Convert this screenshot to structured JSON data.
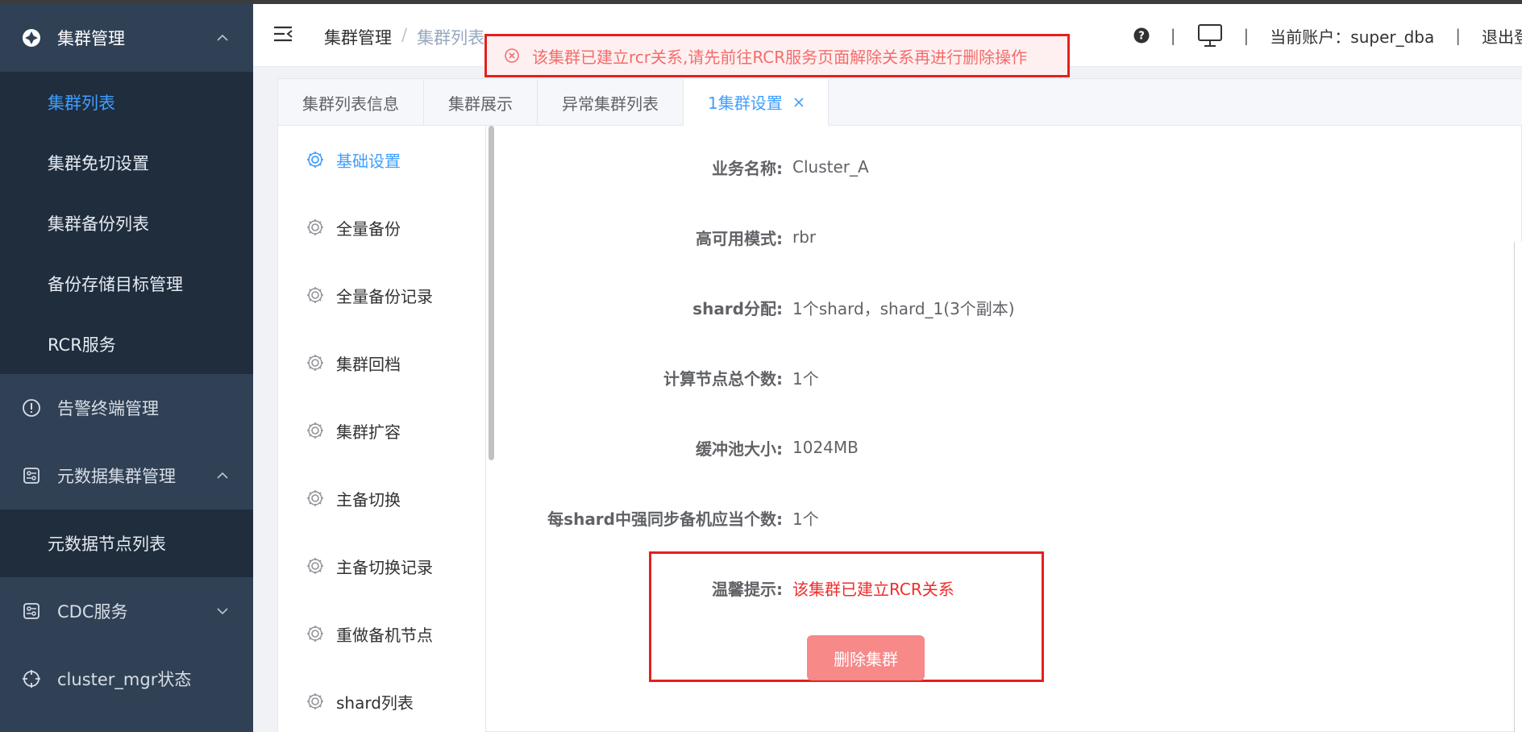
{
  "sidebar": {
    "groups": [
      {
        "label": "集群管理",
        "icon": "cluster-icon",
        "expanded": true,
        "items": [
          {
            "label": "集群列表",
            "active": true
          },
          {
            "label": "集群免切设置"
          },
          {
            "label": "集群备份列表"
          },
          {
            "label": "备份存储目标管理"
          },
          {
            "label": "RCR服务"
          }
        ]
      },
      {
        "label": "告警终端管理",
        "icon": "alert-icon"
      },
      {
        "label": "元数据集群管理",
        "icon": "metadata-icon",
        "expanded": true,
        "items": [
          {
            "label": "元数据节点列表"
          }
        ]
      },
      {
        "label": "CDC服务",
        "icon": "cdc-icon",
        "expanded": false
      },
      {
        "label": "cluster_mgr状态",
        "icon": "status-icon"
      }
    ]
  },
  "header": {
    "breadcrumb": {
      "root": "集群管理",
      "separator": "/",
      "current": "集群列表"
    },
    "account_label": "当前账户：super_dba",
    "logout": "退出登录",
    "divider": "|"
  },
  "toast": {
    "message": "该集群已建立rcr关系,请先前往RCR服务页面解除关系再进行删除操作"
  },
  "tabs": [
    {
      "label": "集群列表信息"
    },
    {
      "label": "集群展示"
    },
    {
      "label": "异常集群列表"
    },
    {
      "label": "1集群设置",
      "active": true,
      "closable": true
    }
  ],
  "settings_menu": [
    {
      "label": "基础设置",
      "active": true
    },
    {
      "label": "全量备份"
    },
    {
      "label": "全量备份记录"
    },
    {
      "label": "集群回档"
    },
    {
      "label": "集群扩容"
    },
    {
      "label": "主备切换"
    },
    {
      "label": "主备切换记录"
    },
    {
      "label": "重做备机节点"
    },
    {
      "label": "shard列表"
    }
  ],
  "form": {
    "rows": [
      {
        "label": "业务名称:",
        "value": "Cluster_A"
      },
      {
        "label": "高可用模式:",
        "value": "rbr"
      },
      {
        "label": "shard分配:",
        "value": "1个shard，shard_1(3个副本)"
      },
      {
        "label": "计算节点总个数:",
        "value": "1个"
      },
      {
        "label": "缓冲池大小:",
        "value": "1024MB"
      },
      {
        "label": "每shard中强同步备机应当个数:",
        "value": "1个"
      },
      {
        "label": "温馨提示:",
        "value": "该集群已建立RCR关系"
      }
    ],
    "delete_button": "删除集群"
  },
  "colors": {
    "accent": "#409eff",
    "sidebar_bg": "#304156",
    "error": "#f56c6c",
    "highlight_border": "#e5201c"
  }
}
